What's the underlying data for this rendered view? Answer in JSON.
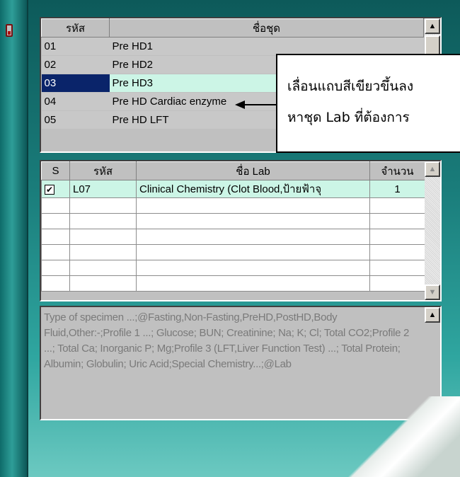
{
  "set_grid": {
    "headers": {
      "code": "รหัส",
      "name": "ชื่อชุด"
    },
    "rows": [
      {
        "code": "01",
        "name": "Pre HD1"
      },
      {
        "code": "02",
        "name": "Pre HD2"
      },
      {
        "code": "03",
        "name": "Pre HD3"
      },
      {
        "code": "04",
        "name": "Pre HD Cardiac enzyme"
      },
      {
        "code": "05",
        "name": "Pre HD LFT"
      }
    ],
    "selected_row": "03"
  },
  "callout": {
    "line1": "เลื่อนแถบสีเขียวขึ้นลง",
    "line2": "หาชุด Lab ที่ต้องการ"
  },
  "lab_grid": {
    "headers": {
      "s": "S",
      "code": "รหัส",
      "name": "ชื่อ Lab",
      "qty": "จำนวน"
    },
    "rows": [
      {
        "checked": true,
        "code": "L07",
        "name": "Clinical Chemistry  (Clot Blood,ป้ายฟ้าจุ",
        "qty": "1"
      }
    ]
  },
  "specimen": {
    "text": "Type of specimen ...;@Fasting,Non-Fasting,PreHD,PostHD,Body Fluid,Other:-;Profile 1 ...;  Glucose;  BUN;  Creatinine; Na;  K;  Cl;  Total CO2;Profile 2 ...;  Total Ca;  Inorganic P;  Mg;Profile 3 (LFT,Liver Function Test) ...;  Total Protein; Albumin;  Globulin;  Uric Acid;Special Chemistry...;@Lab"
  },
  "icons": {
    "scroll_up": "scroll-up-icon",
    "scroll_down": "scroll-down-icon",
    "check": "check-icon",
    "arrow": "pointer-arrow-icon"
  },
  "colors": {
    "selection": "#0a246a",
    "highlight_green": "#ccf5e6",
    "background_teal": "#1a7d7b"
  }
}
